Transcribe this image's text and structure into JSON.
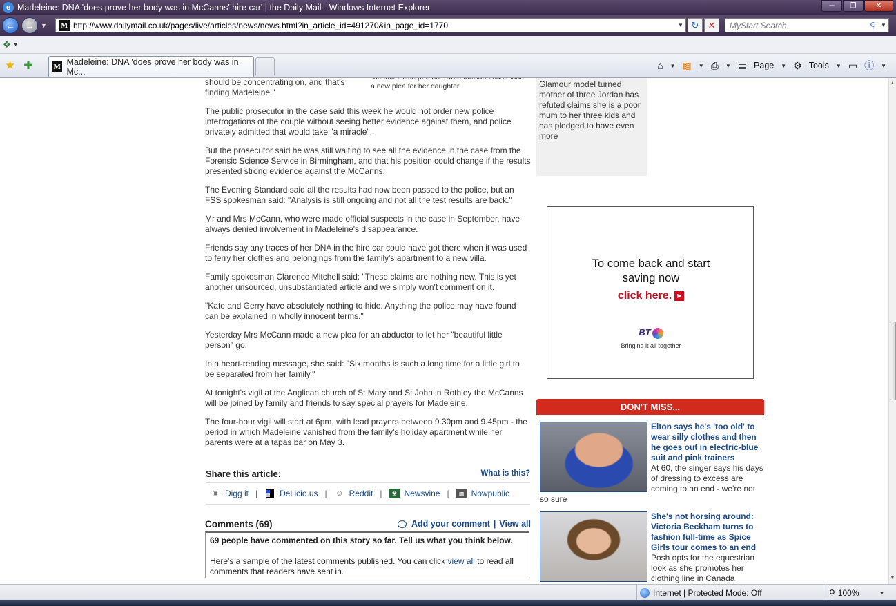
{
  "window": {
    "title": "Madeleine: DNA 'does prove her body was in McCanns' hire car' | the Daily Mail - Windows Internet Explorer",
    "favicon_letter": "M",
    "logo_letter": "e"
  },
  "nav": {
    "url": "http://www.dailymail.co.uk/pages/live/articles/news/news.html?in_article_id=491270&in_page_id=1770",
    "search_placeholder": "MyStart Search"
  },
  "tab": {
    "title": "Madeleine: DNA 'does prove her body was in Mc..."
  },
  "commandbar": {
    "page_label": "Page",
    "tools_label": "Tools"
  },
  "article": {
    "first_para_tail": "should be concentrating on, and that's finding Madeleine.\"",
    "caption_tail": "\"beautiful little person\": Kate McCann has made a new plea for her daughter",
    "paragraphs": [
      "The public prosecutor in the case said this week he would not order new police interrogations of the couple without seeing better evidence against them, and police privately admitted that would take \"a miracle\".",
      "But the prosecutor said he was still waiting to see all the evidence in the case from the Forensic Science Service in Birmingham, and that his position could change if the results presented strong evidence against the McCanns.",
      "The Evening Standard said all the results had now been passed to the police, but an FSS spokesman said: \"Analysis is still ongoing and not all the test results are back.\"",
      "Mr and Mrs McCann, who were made official suspects in the case in September, have always denied involvement in Madeleine's disappearance.",
      "Friends say any traces of her DNA in the hire car could have got there when it was used to ferry her clothes and belongings from the family's apartment to a new villa.",
      "Family spokesman Clarence Mitchell said: \"These claims are nothing new. This is yet another unsourced, unsubstantiated article and we simply won't comment on it.",
      "\"Kate and Gerry have absolutely nothing to hide. Anything the police may have found can be explained in wholly innocent terms.\"",
      "Yesterday Mrs McCann made a new plea for an abductor to let her \"beautiful little person\" go.",
      "In a heart-rending message, she said: \"Six months is such a long time for a little girl to be separated from her family.\"",
      "At tonight's vigil at the Anglican church of St Mary and St John in Rothley the McCanns will be joined by family and friends to say special prayers for Madeleine.",
      "The four-hour vigil will start at 6pm, with lead prayers between 9.30pm and 9.45pm - the period in which Madeleine vanished from the family's holiday apartment while her parents were at a tapas bar on May 3."
    ]
  },
  "share": {
    "title": "Share this article:",
    "what_link": "What is this?",
    "services": [
      "Digg it",
      "Del.icio.us",
      "Reddit",
      "Newsvine",
      "Nowpublic"
    ]
  },
  "comments": {
    "title": "Comments (69)",
    "add_label": "Add your comment",
    "view_all_label": "View all",
    "summary": "69 people have commented on this story so far. Tell us what you think below.",
    "sample_before": "Here's a sample of the latest comments published. You can click ",
    "sample_link": "view all",
    "sample_after": " to read all comments that readers have sent in."
  },
  "sidebar": {
    "jordan_text": "Glamour model turned mother of three Jordan has refuted claims she is a poor mum to her three kids and has pledged to have even more"
  },
  "ad": {
    "line1": "To come back and start",
    "line2": "saving now",
    "click": "click here.",
    "brand": "BT",
    "tagline": "Bringing it all together"
  },
  "dont_miss": {
    "header": "DON'T MISS...",
    "items": [
      {
        "title": "Elton says he's 'too old' to wear silly clothes and then he goes out in electric-blue suit and pink trainers",
        "desc": "At 60, the singer says his days of dressing to excess are coming to an end - we're not so sure"
      },
      {
        "title": "She's not horsing around: Victoria Beckham turns to fashion full-time as Spice Girls tour comes to an end",
        "desc": "Posh opts for the equestrian look as she promotes her clothing line in Canada"
      }
    ]
  },
  "status": {
    "zone": "Internet | Protected Mode: Off",
    "zoom": "100%"
  }
}
